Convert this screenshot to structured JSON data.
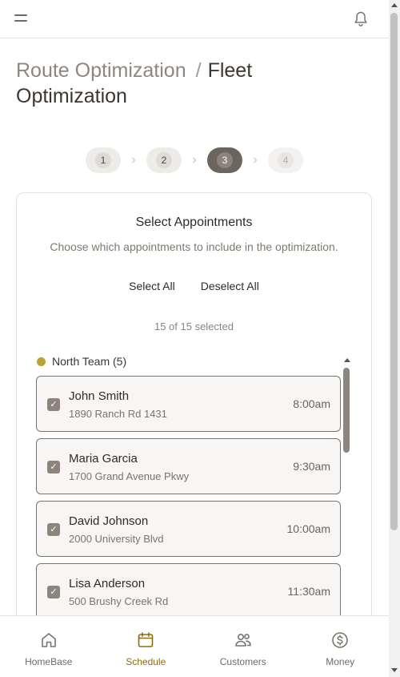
{
  "header": {
    "menu_icon": "hamburger-icon",
    "bell_icon": "bell-icon"
  },
  "breadcrumb": {
    "parent": "Route Optimization",
    "separator": "/",
    "current": "Fleet Optimization"
  },
  "stepper": {
    "steps": [
      "1",
      "2",
      "3",
      "4"
    ],
    "active": 3
  },
  "card": {
    "title": "Select Appointments",
    "subtitle": "Choose which appointments to include in the optimization.",
    "select_all": "Select All",
    "deselect_all": "Deselect All",
    "selected_count": "15 of 15 selected"
  },
  "group": {
    "label": "North Team (5)",
    "color": "#bfa033"
  },
  "appointments": [
    {
      "name": "John Smith",
      "address": "1890 Ranch Rd 1431",
      "time": "8:00am",
      "checked": true
    },
    {
      "name": "Maria Garcia",
      "address": "1700 Grand Avenue Pkwy",
      "time": "9:30am",
      "checked": true
    },
    {
      "name": "David Johnson",
      "address": "2000 University Blvd",
      "time": "10:00am",
      "checked": true
    },
    {
      "name": "Lisa Anderson",
      "address": "500 Brushy Creek Rd",
      "time": "11:30am",
      "checked": true
    }
  ],
  "nav": {
    "items": [
      {
        "label": "HomeBase",
        "icon": "home-icon"
      },
      {
        "label": "Schedule",
        "icon": "calendar-icon"
      },
      {
        "label": "Customers",
        "icon": "users-icon"
      },
      {
        "label": "Money",
        "icon": "dollar-icon"
      }
    ],
    "active": "Schedule"
  },
  "colors": {
    "accent": "#8a6d12",
    "step_active": "#6c655e"
  }
}
